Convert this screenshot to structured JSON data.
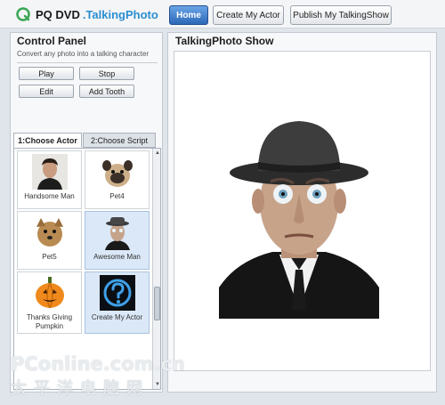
{
  "app": {
    "logo_text": "PQ DVD",
    "logo_sub": ".TalkingPhoto"
  },
  "topnav": {
    "home_label": "Home",
    "create_actor_label": "Create My Actor",
    "publish_label": "Publish My TalkingShow"
  },
  "control_panel": {
    "title": "Control Panel",
    "subtitle": "Convert any photo into a talking character",
    "play_label": "Play",
    "stop_label": "Stop",
    "edit_label": "Edit",
    "add_tooth_label": "Add Tooth"
  },
  "tabs": [
    {
      "label": "1:Choose Actor",
      "active": true
    },
    {
      "label": "2:Choose Script",
      "active": false
    }
  ],
  "actors": [
    {
      "label": "Handsome Man",
      "selected": false
    },
    {
      "label": "Pet4",
      "selected": false
    },
    {
      "label": "Pet5",
      "selected": false
    },
    {
      "label": "Awesome Man",
      "selected": true
    },
    {
      "label": "Thanks Giving Pumpkin",
      "selected": false
    },
    {
      "label": "Create My Actor",
      "selected": true
    }
  ],
  "show": {
    "title": "TalkingPhoto Show"
  },
  "watermark": {
    "text": "PConline.com.cn",
    "sub": "太平洋电脑网"
  },
  "colors": {
    "accent": "#2c67b8",
    "logo_blue": "#2a8ed0",
    "selected_bg": "#dbe8f7"
  }
}
